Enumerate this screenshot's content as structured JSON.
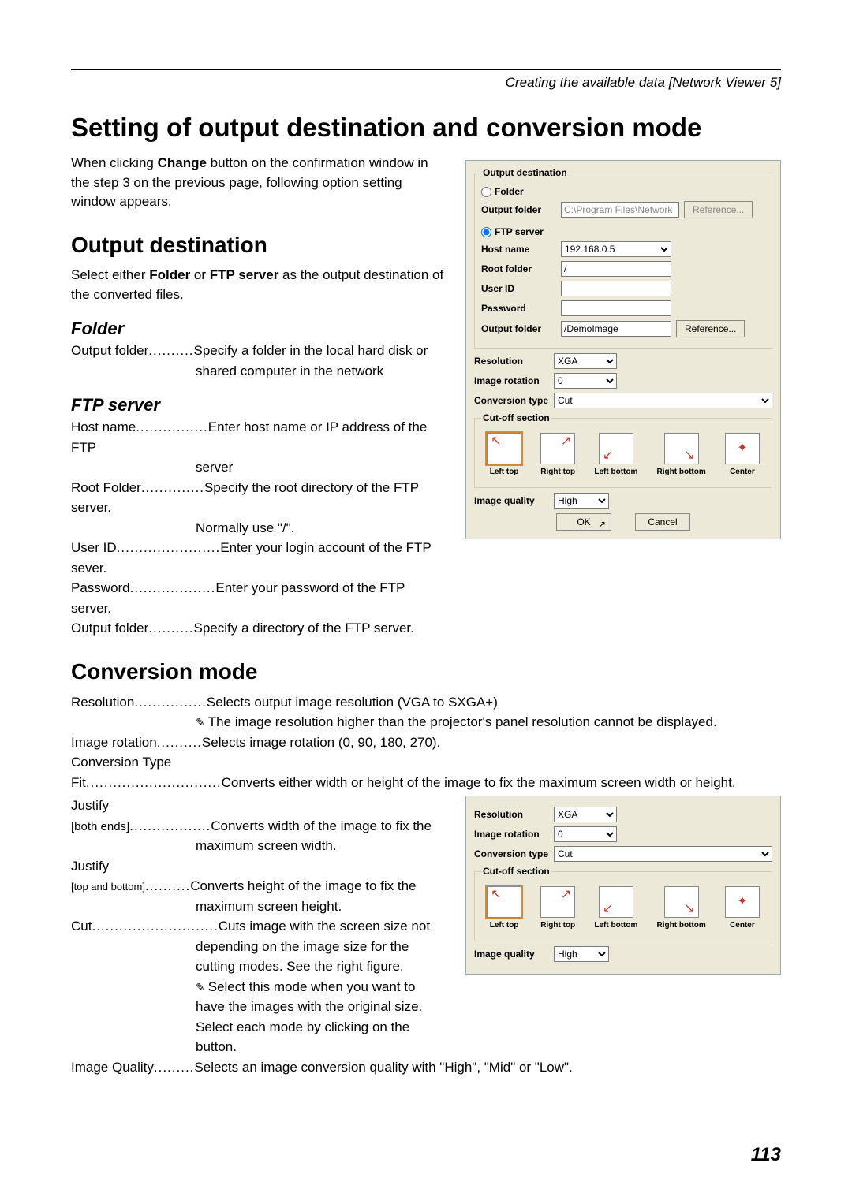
{
  "header": "Creating the available data [Network Viewer 5]",
  "h1": "Setting of output destination and conversion mode",
  "intro_pre": "When clicking ",
  "intro_bold": "Change",
  "intro_post": " button on the confirmation window in the step 3 on the previous page, following option setting window appears.",
  "h2_output": "Output destination",
  "output_pre": "Select either ",
  "output_bold1": "Folder",
  "output_mid": " or ",
  "output_bold2": "FTP server",
  "output_post": " as the output destination of the converted files.",
  "h3_folder": "Folder",
  "folder_item_term": "Output folder",
  "folder_item_dots": "..........",
  "folder_item_def": "Specify a folder in the local hard disk or",
  "folder_item_def2": "shared computer in the network",
  "h3_ftp": "FTP server",
  "ftp_items": [
    {
      "term": "Host name",
      "dots": "................",
      "def": "Enter host name or IP address of the FTP",
      "def2": "server"
    },
    {
      "term": "Root Folder",
      "dots": "..............",
      "def": "Specify the root directory of the FTP server.",
      "def2": "Normally use \"/\"."
    },
    {
      "term": "User ID",
      "dots": ".......................",
      "def": "Enter your login account of the FTP sever.",
      "def2": ""
    },
    {
      "term": "Password",
      "dots": "...................",
      "def": "Enter your password of the FTP server.",
      "def2": ""
    },
    {
      "term": "Output folder",
      "dots": "..........",
      "def": "Specify a directory of the FTP server.",
      "def2": ""
    }
  ],
  "h2_conv": "Conversion mode",
  "conv_items": [
    {
      "term": "Resolution",
      "dots": "................",
      "def": "Selects output image resolution (VGA to SXGA+)"
    },
    {
      "note": "The image resolution higher than the projector's panel resolution cannot be displayed."
    },
    {
      "term": "Image rotation",
      "dots": "..........",
      "def": "Selects image rotation (0, 90, 180, 270)."
    },
    {
      "term": "Conversion Type",
      "dots": "",
      "def": ""
    },
    {
      "term": "Fit",
      "dots": "..............................",
      "def": "Converts either width or height of the image  to fix the maximum screen width or height."
    },
    {
      "term": "Justify",
      "dots": "",
      "def": ""
    },
    {
      "term": "[both ends]",
      "dots": "..................",
      "def": "Converts width of the image to fix the",
      "def2": "maximum screen width."
    },
    {
      "term": "Justify",
      "dots": "",
      "def": ""
    },
    {
      "term": "[top and bottom]",
      "dots": "..........",
      "def": "Converts height of the image to fix the",
      "def2": "maximum screen height."
    },
    {
      "term": "Cut",
      "dots": "............................",
      "def": "Cuts image with the screen size not",
      "def2": "depending on the image size for the",
      "def3": "cutting modes. See the right figure."
    },
    {
      "note": "Select this mode when you want to have the images with the original size. Select each mode by clicking on the button."
    },
    {
      "term": "Image Quality",
      "dots": ".........",
      "def": "Selects an image conversion quality with \"High\", \"Mid\" or \"Low\"."
    }
  ],
  "panel1": {
    "titlebar": "",
    "legend_dest": "Output destination",
    "radio_folder": "Folder",
    "label_output_folder": "Output folder",
    "value_output_folder": "C:\\Program Files\\Network",
    "btn_reference": "Reference...",
    "radio_ftp": "FTP server",
    "label_host": "Host name",
    "value_host": "192.168.0.5",
    "label_root": "Root folder",
    "value_root": "/",
    "label_userid": "User ID",
    "value_userid": "",
    "label_password": "Password",
    "value_password": "",
    "label_output_folder2": "Output folder",
    "value_output_folder2": "/DemoImage",
    "btn_reference2": "Reference...",
    "label_resolution": "Resolution",
    "value_resolution": "XGA",
    "label_rotation": "Image rotation",
    "value_rotation": "0",
    "label_convtype": "Conversion type",
    "value_convtype": "Cut",
    "legend_cutoff": "Cut-off section",
    "cutoff": [
      "Left top",
      "Right top",
      "Left bottom",
      "Right bottom",
      "Center"
    ],
    "label_quality": "Image quality",
    "value_quality": "High",
    "btn_ok": "OK",
    "btn_cancel": "Cancel"
  },
  "panel2": {
    "label_resolution": "Resolution",
    "value_resolution": "XGA",
    "label_rotation": "Image rotation",
    "value_rotation": "0",
    "label_convtype": "Conversion type",
    "value_convtype": "Cut",
    "legend_cutoff": "Cut-off section",
    "cutoff": [
      "Left top",
      "Right top",
      "Left bottom",
      "Right bottom",
      "Center"
    ],
    "label_quality": "Image quality",
    "value_quality": "High"
  },
  "page_number": "113"
}
